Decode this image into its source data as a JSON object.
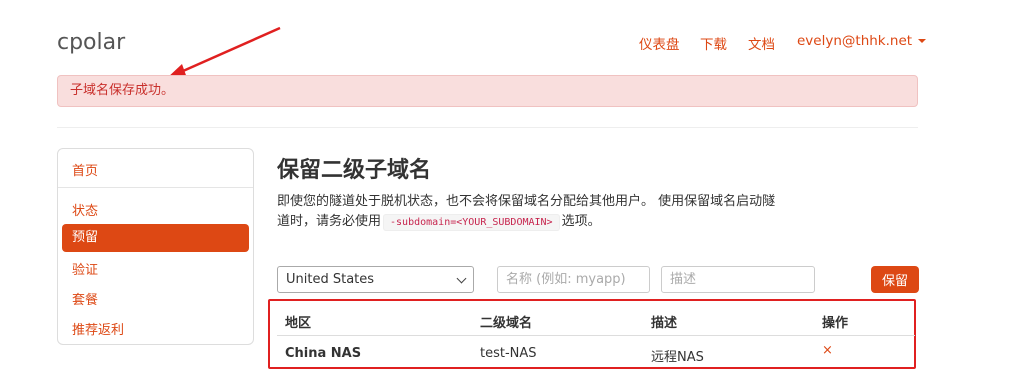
{
  "header": {
    "brand": "cpolar",
    "nav": {
      "dashboard": "仪表盘",
      "download": "下载",
      "docs": "文档",
      "user": "evelyn@thhk.net"
    }
  },
  "alert": {
    "message": "子域名保存成功。"
  },
  "sidebar": {
    "home": "首页",
    "items": [
      "状态",
      "预留",
      "验证",
      "套餐",
      "推荐返利"
    ],
    "active": "预留"
  },
  "main": {
    "title": "保留二级子域名",
    "desc_before": "即使您的隧道处于脱机状态，也不会将保留域名分配给其他用户。 使用保留域名启动隧道时，请务必使用",
    "desc_code": "-subdomain=<YOUR_SUBDOMAIN>",
    "desc_after": "选项。"
  },
  "form": {
    "region_selected": "United States",
    "name_placeholder": "名称 (例如: myapp)",
    "desc_placeholder": "描述",
    "save_label": "保留"
  },
  "table": {
    "headers": [
      "地区",
      "二级域名",
      "描述",
      "操作"
    ],
    "rows": [
      {
        "region": "China NAS",
        "subdomain": "test-NAS",
        "description": "远程NAS",
        "action": "×"
      }
    ]
  },
  "colors": {
    "accent": "#dd4814",
    "alert_bg": "#f9dedd",
    "alert_text": "#c9302c",
    "annotation_red": "#e02020"
  }
}
